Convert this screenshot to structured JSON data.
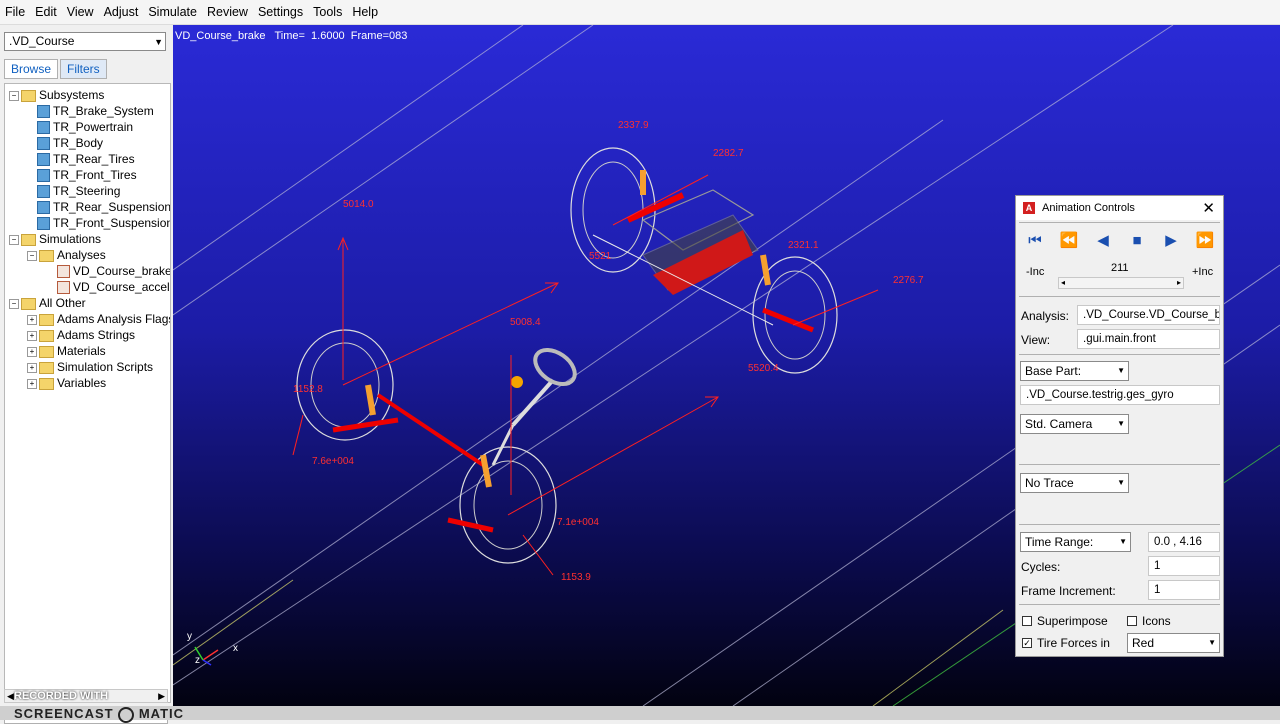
{
  "menu": [
    "File",
    "Edit",
    "View",
    "Adjust",
    "Simulate",
    "Review",
    "Settings",
    "Tools",
    "Help"
  ],
  "left_panel": {
    "model_select": ".VD_Course",
    "tabs": [
      "Browse",
      "Filters"
    ],
    "tree": [
      {
        "label": "Subsystems",
        "icon": "folder",
        "expander": "−"
      },
      {
        "label": "TR_Brake_System",
        "icon": "subsystem"
      },
      {
        "label": "TR_Powertrain",
        "icon": "subsystem"
      },
      {
        "label": "TR_Body",
        "icon": "subsystem"
      },
      {
        "label": "TR_Rear_Tires",
        "icon": "subsystem"
      },
      {
        "label": "TR_Front_Tires",
        "icon": "subsystem"
      },
      {
        "label": "TR_Steering",
        "icon": "subsystem"
      },
      {
        "label": "TR_Rear_Suspension",
        "icon": "subsystem"
      },
      {
        "label": "TR_Front_Suspension",
        "icon": "subsystem"
      },
      {
        "label": "Simulations",
        "icon": "folder",
        "expander": "−"
      },
      {
        "label": "Analyses",
        "icon": "folder",
        "expander": "−"
      },
      {
        "label": "VD_Course_brake",
        "icon": "analysis"
      },
      {
        "label": "VD_Course_accel",
        "icon": "analysis"
      },
      {
        "label": "All Other",
        "icon": "folder",
        "expander": "−"
      },
      {
        "label": "Adams Analysis Flags",
        "icon": "folder",
        "expander": "+"
      },
      {
        "label": "Adams Strings",
        "icon": "folder",
        "expander": "+"
      },
      {
        "label": "Materials",
        "icon": "folder",
        "expander": "+"
      },
      {
        "label": "Simulation Scripts",
        "icon": "folder",
        "expander": "+"
      },
      {
        "label": "Variables",
        "icon": "folder",
        "expander": "+"
      }
    ],
    "search": "Search"
  },
  "viewport": {
    "status": "VD_Course_brake   Time=  1.6000  Frame=083",
    "force_labels": [
      "2337.9",
      "2282.7",
      "5014.0",
      "2321.1",
      "2276.7",
      "5521",
      "5008.4",
      "5520.4",
      "7.6e+004",
      "7.1e+004",
      "1153.9",
      "1152.8"
    ],
    "triad": [
      "y",
      "z",
      "x"
    ]
  },
  "animation_controls": {
    "title": "Animation Controls",
    "frame": "211",
    "dec_inc": "-Inc",
    "inc": "+Inc",
    "analysis_label": "Analysis:",
    "analysis_value": ".VD_Course.VD_Course_b",
    "view_label": "View:",
    "view_value": ".gui.main.front",
    "base_part": "Base Part:",
    "base_part_value": ".VD_Course.testrig.ges_gyro",
    "camera": "Std. Camera",
    "trace": "No Trace",
    "time_range": "Time Range:",
    "time_range_value": "0.0 , 4.16",
    "cycles_label": "Cycles:",
    "cycles_value": "1",
    "frame_inc_label": "Frame Increment:",
    "frame_inc_value": "1",
    "superimpose": "Superimpose",
    "icons": "Icons",
    "tire_forces": "Tire Forces in",
    "tire_forces_checked": true,
    "tire_color": "Red"
  },
  "watermark": [
    "RECORDED WITH",
    "SCREENCAST",
    "MATIC"
  ],
  "colors": {
    "force": "#ff2020",
    "viewport_top": "#2a2ad6",
    "button_blue": "#1a4fb0"
  }
}
